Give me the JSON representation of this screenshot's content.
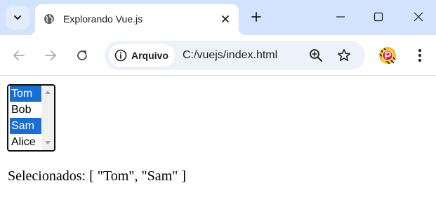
{
  "browser": {
    "tab": {
      "title": "Explorando Vue.js"
    },
    "toolbar": {
      "site_info_label": "Arquivo",
      "url": "C:/vuejs/index.html"
    },
    "icons": [
      "chevron-down-icon",
      "globe-icon",
      "close-icon",
      "plus-icon",
      "minimize-icon",
      "maximize-icon",
      "window-close-icon",
      "back-icon",
      "forward-icon",
      "reload-icon",
      "info-icon",
      "zoom-icon",
      "star-icon",
      "profile-icon",
      "more-vert-icon"
    ]
  },
  "page": {
    "listbox": {
      "options": [
        {
          "label": "Tom",
          "selected": true
        },
        {
          "label": "Bob",
          "selected": false
        },
        {
          "label": "Sam",
          "selected": true
        },
        {
          "label": "Alice",
          "selected": false
        }
      ]
    },
    "selected_text": "Selecionados: [ \"Tom\", \"Sam\" ]"
  },
  "colors": {
    "tabstrip_bg": "#d3e3fd",
    "omnibox_bg": "#edf2fa",
    "selection": "#1a6dd1"
  }
}
